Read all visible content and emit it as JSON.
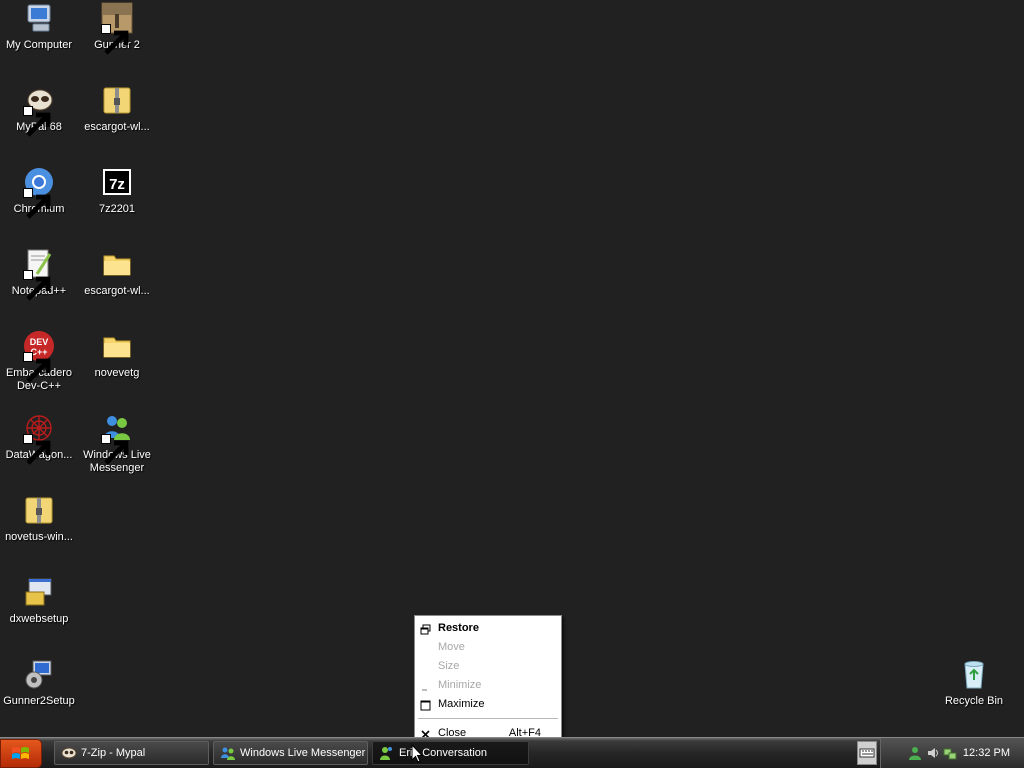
{
  "desktop": {
    "icons": [
      {
        "label": "My Computer",
        "icon": "my-computer-icon"
      },
      {
        "label": "Gunner 2",
        "icon": "gunner2-game-icon"
      },
      {
        "label": "MyPal 68",
        "icon": "mypal-browser-icon"
      },
      {
        "label": "escargot-wl...",
        "icon": "zip-folder-icon"
      },
      {
        "label": "Chromium",
        "icon": "chromium-icon"
      },
      {
        "label": "7z2201",
        "icon": "7zip-icon"
      },
      {
        "label": "Notepad++",
        "icon": "notepad-plus-plus-icon"
      },
      {
        "label": "escargot-wl...",
        "icon": "folder-icon"
      },
      {
        "label": "Embarcadero Dev-C++",
        "icon": "dev-cpp-icon"
      },
      {
        "label": "novevetg",
        "icon": "folder-icon"
      },
      {
        "label": "DataWagon...",
        "icon": "datawagon-icon"
      },
      {
        "label": "Windows Live Messenger",
        "icon": "windows-live-messenger-icon"
      },
      {
        "label": "novetus-win...",
        "icon": "zip-folder-icon"
      },
      {
        "label": "dxwebsetup",
        "icon": "installer-icon"
      },
      {
        "label": "Gunner2Setup",
        "icon": "setup-icon"
      },
      {
        "label": "Recycle Bin",
        "icon": "recycle-bin-icon"
      }
    ]
  },
  "context_menu": {
    "items": [
      {
        "label": "Restore",
        "icon": "restore-icon",
        "enabled": true,
        "bold": true
      },
      {
        "label": "Move",
        "enabled": false
      },
      {
        "label": "Size",
        "enabled": false
      },
      {
        "label": "Minimize",
        "icon": "minimize-icon",
        "enabled": false
      },
      {
        "label": "Maximize",
        "icon": "maximize-icon",
        "enabled": true
      }
    ],
    "close": {
      "label": "Close",
      "accelerator": "Alt+F4",
      "icon": "close-icon"
    }
  },
  "taskbar": {
    "buttons": [
      {
        "label": "7-Zip - Mypal",
        "icon": "mypal-browser-icon"
      },
      {
        "label": "Windows Live Messenger",
        "icon": "windows-live-messenger-icon"
      },
      {
        "label": "Eri - Conversation",
        "icon": "conversation-icon",
        "active": true
      }
    ],
    "tray": {
      "clock": "12:32 PM"
    }
  },
  "colors": {
    "desktop": "#212121",
    "start_button": "#d4461a",
    "taskbar": "#262626"
  }
}
